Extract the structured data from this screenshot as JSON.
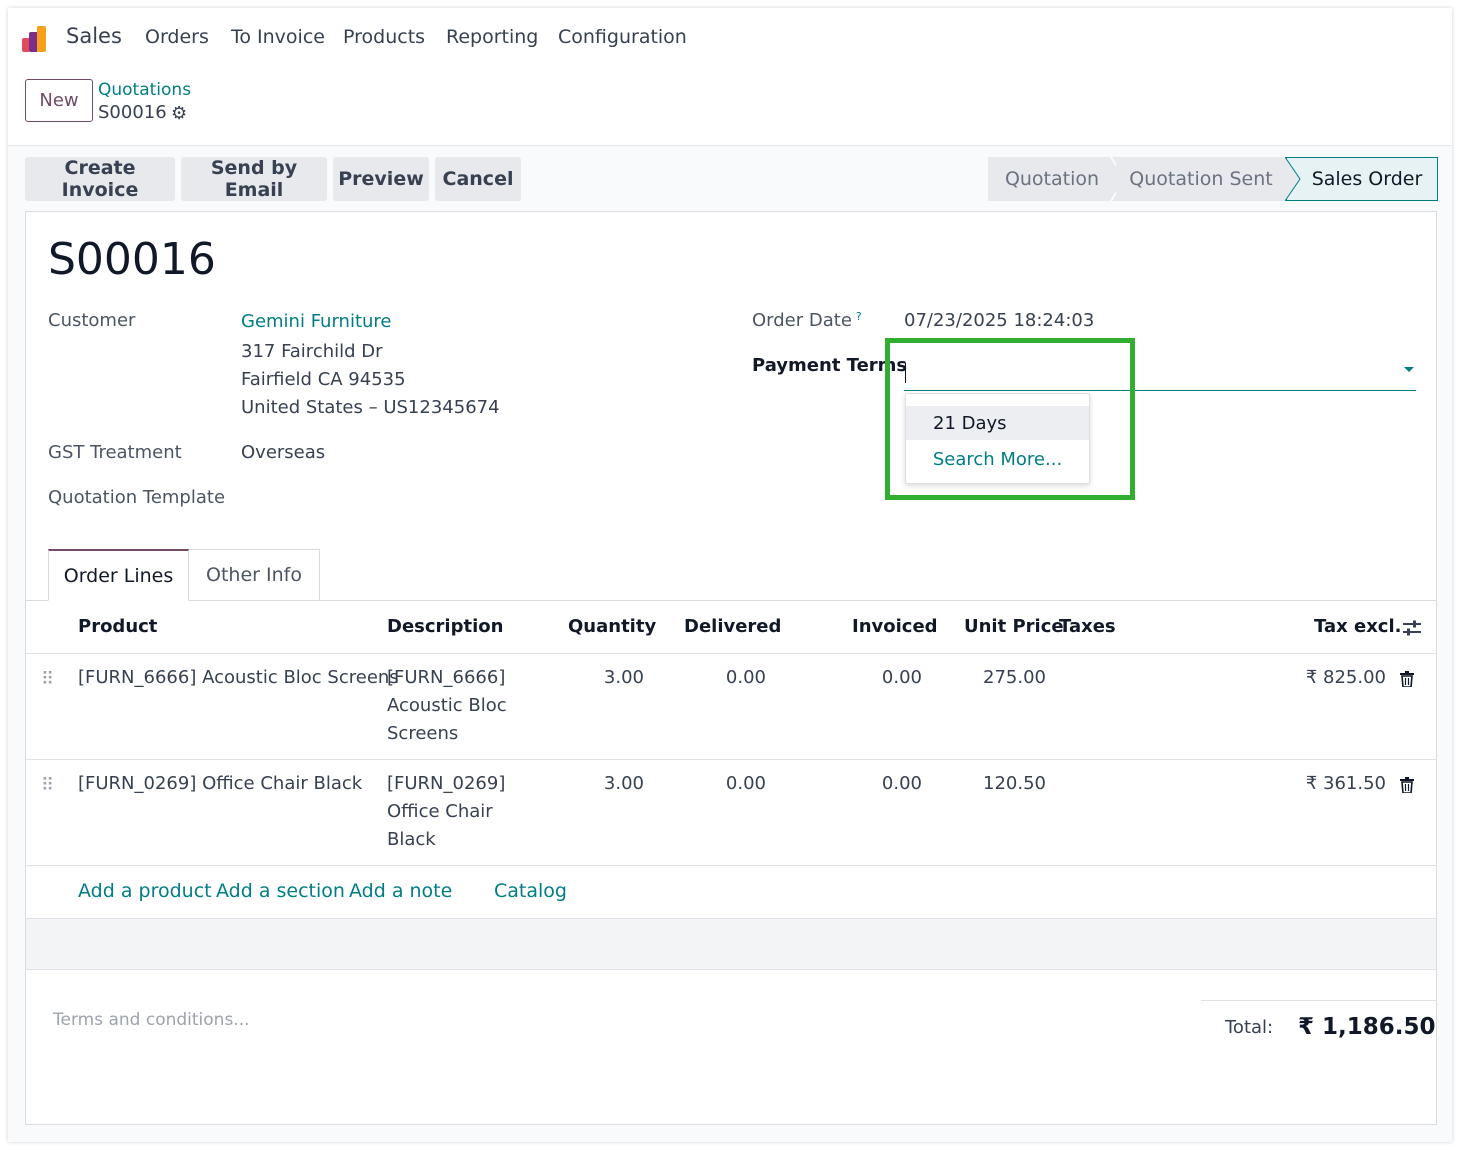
{
  "nav": {
    "app": "Sales",
    "items": [
      "Orders",
      "To Invoice",
      "Products",
      "Reporting",
      "Configuration"
    ]
  },
  "breadcrumb": {
    "new_label": "New",
    "parent": "Quotations",
    "current": "S00016"
  },
  "actions": [
    "Create Invoice",
    "Send by Email",
    "Preview",
    "Cancel"
  ],
  "status": {
    "stages": [
      "Quotation",
      "Quotation Sent",
      "Sales Order"
    ],
    "active": "Sales Order"
  },
  "form": {
    "title": "S00016",
    "customer_label": "Customer",
    "customer_name": "Gemini Furniture",
    "address_line1": "317 Fairchild Dr",
    "address_line2": "Fairfield CA 94535",
    "address_line3": "United States – US12345674",
    "gst_label": "GST Treatment",
    "gst_value": "Overseas",
    "template_label": "Quotation Template",
    "order_date_label": "Order Date",
    "order_date_help": "?",
    "order_date_value": "07/23/2025 18:24:03",
    "payment_terms_label": "Payment Terms",
    "payment_terms_value": "",
    "dropdown": {
      "option": "21 Days",
      "search_more": "Search More..."
    }
  },
  "tabs": [
    "Order Lines",
    "Other Info"
  ],
  "table": {
    "headers": {
      "product": "Product",
      "description": "Description",
      "quantity": "Quantity",
      "delivered": "Delivered",
      "invoiced": "Invoiced",
      "unit_price": "Unit Price",
      "taxes": "Taxes",
      "tax_excl": "Tax excl."
    },
    "rows": [
      {
        "product": "[FURN_6666] Acoustic Bloc Screens",
        "description": [
          "[FURN_6666]",
          "Acoustic Bloc",
          "Screens"
        ],
        "quantity": "3.00",
        "delivered": "0.00",
        "invoiced": "0.00",
        "unit_price": "275.00",
        "taxes": "",
        "subtotal": "₹ 825.00"
      },
      {
        "product": "[FURN_0269] Office Chair Black",
        "description": [
          "[FURN_0269]",
          "Office Chair",
          "Black"
        ],
        "quantity": "3.00",
        "delivered": "0.00",
        "invoiced": "0.00",
        "unit_price": "120.50",
        "taxes": "",
        "subtotal": "₹ 361.50"
      }
    ],
    "add_links": [
      "Add a product",
      "Add a section",
      "Add a note",
      "Catalog"
    ]
  },
  "footer": {
    "terms_placeholder": "Terms and conditions...",
    "total_label": "Total:",
    "total_value": "₹ 1,186.50"
  },
  "colors": {
    "brand": "#714b67",
    "link": "#017e84",
    "highlight": "#2fae2f"
  }
}
